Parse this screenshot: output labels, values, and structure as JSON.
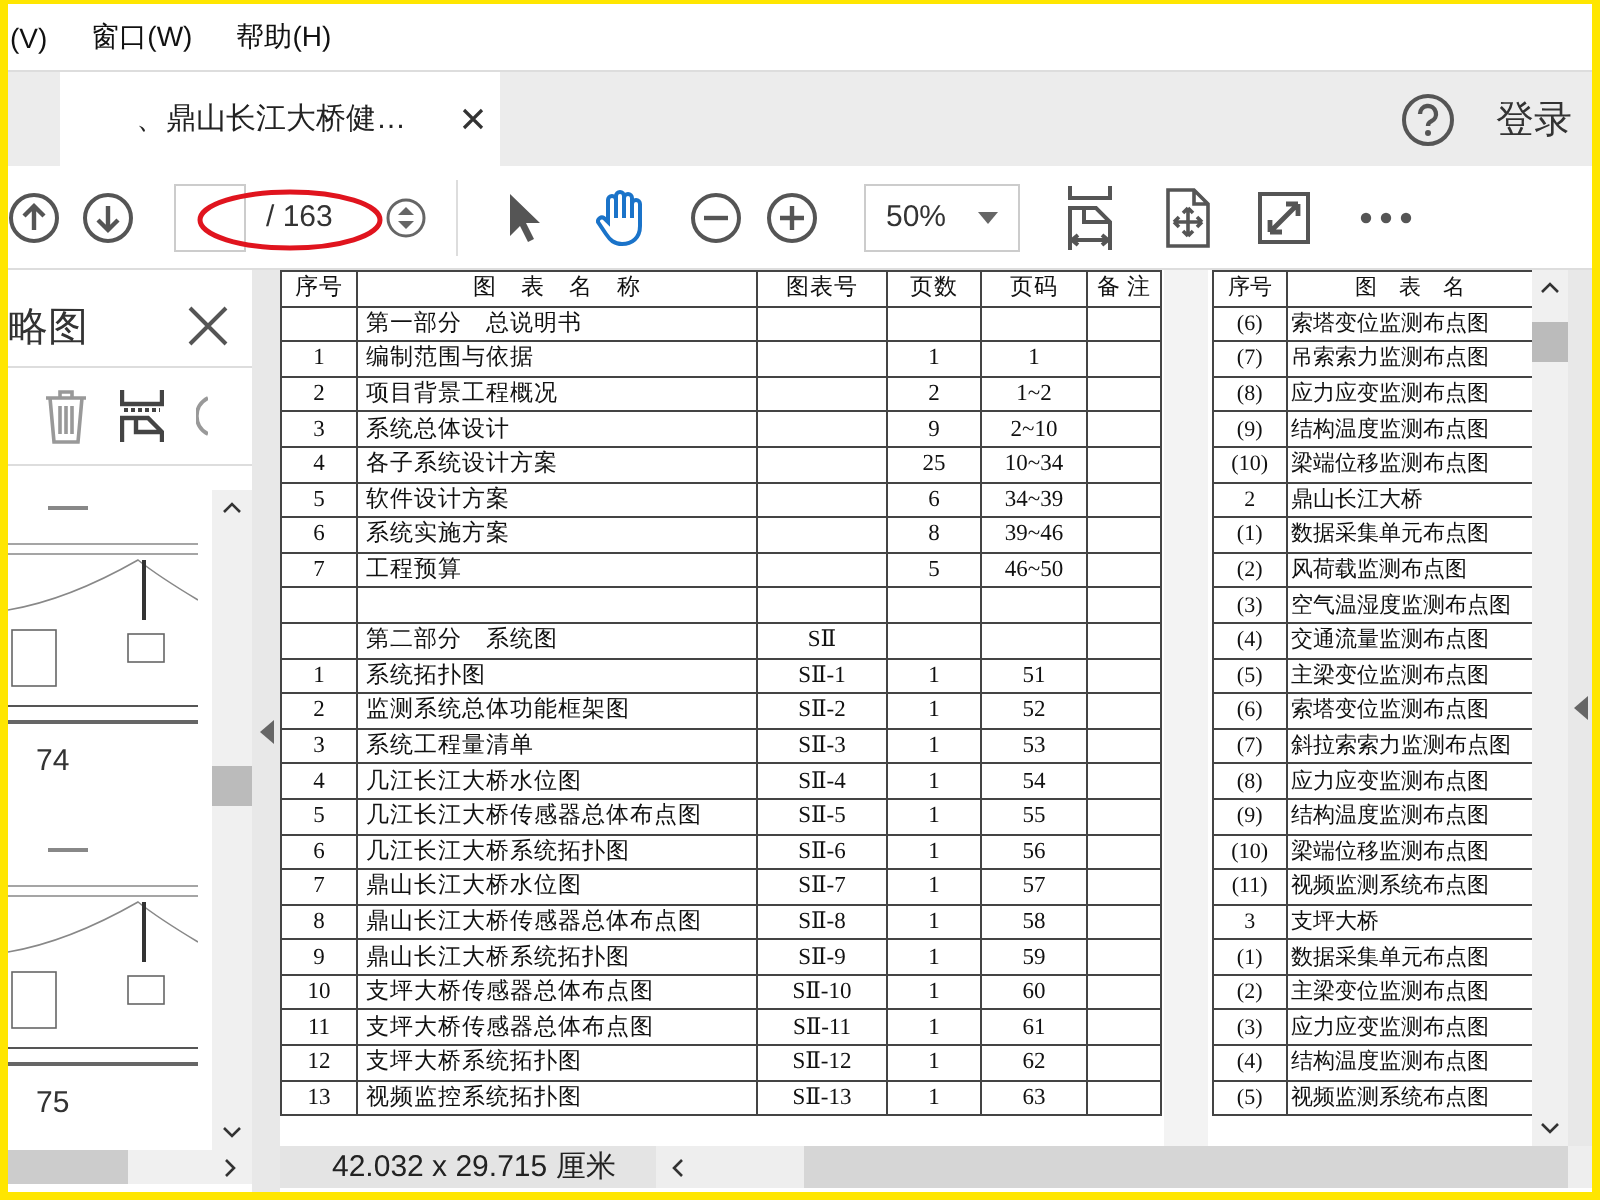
{
  "menu": [
    {
      "label": "(V)"
    },
    {
      "label": "窗口(W)"
    },
    {
      "label": "帮助(H)"
    }
  ],
  "tabs": [
    {
      "title": "、鼎山长江大桥健…",
      "selected": true
    }
  ],
  "account": {
    "label": "登录"
  },
  "toolbar": {
    "page_total": "/ 163",
    "zoom": "50%"
  },
  "sidebar": {
    "title": "略图",
    "pages": [
      {
        "label": "74"
      },
      {
        "label": "75"
      }
    ]
  },
  "document": {
    "left_table": {
      "columns": [
        "序号",
        "图　表　名　称",
        "图表号",
        "页数",
        "页码",
        "备 注"
      ],
      "rows": [
        {
          "name": "第一部分　总说明书"
        },
        {
          "no": "1",
          "name": "编制范围与依据",
          "pages": "1",
          "page_range": "1"
        },
        {
          "no": "2",
          "name": "项目背景工程概况",
          "pages": "2",
          "page_range": "1~2"
        },
        {
          "no": "3",
          "name": "系统总体设计",
          "pages": "9",
          "page_range": "2~10"
        },
        {
          "no": "4",
          "name": "各子系统设计方案",
          "pages": "25",
          "page_range": "10~34"
        },
        {
          "no": "5",
          "name": "软件设计方案",
          "pages": "6",
          "page_range": "34~39"
        },
        {
          "no": "6",
          "name": "系统实施方案",
          "pages": "8",
          "page_range": "39~46"
        },
        {
          "no": "7",
          "name": "工程预算",
          "pages": "5",
          "page_range": "46~50"
        },
        {},
        {
          "name": "第二部分　系统图",
          "code": "SⅡ"
        },
        {
          "no": "1",
          "name": "系统拓扑图",
          "code": "SⅡ-1",
          "pages": "1",
          "page_range": "51"
        },
        {
          "no": "2",
          "name": "监测系统总体功能框架图",
          "code": "SⅡ-2",
          "pages": "1",
          "page_range": "52"
        },
        {
          "no": "3",
          "name": "系统工程量清单",
          "code": "SⅡ-3",
          "pages": "1",
          "page_range": "53"
        },
        {
          "no": "4",
          "name": "几江长江大桥水位图",
          "code": "SⅡ-4",
          "pages": "1",
          "page_range": "54"
        },
        {
          "no": "5",
          "name": "几江长江大桥传感器总体布点图",
          "code": "SⅡ-5",
          "pages": "1",
          "page_range": "55"
        },
        {
          "no": "6",
          "name": "几江长江大桥系统拓扑图",
          "code": "SⅡ-6",
          "pages": "1",
          "page_range": "56"
        },
        {
          "no": "7",
          "name": "鼎山长江大桥水位图",
          "code": "SⅡ-7",
          "pages": "1",
          "page_range": "57"
        },
        {
          "no": "8",
          "name": "鼎山长江大桥传感器总体布点图",
          "code": "SⅡ-8",
          "pages": "1",
          "page_range": "58"
        },
        {
          "no": "9",
          "name": "鼎山长江大桥系统拓扑图",
          "code": "SⅡ-9",
          "pages": "1",
          "page_range": "59"
        },
        {
          "no": "10",
          "name": "支坪大桥传感器总体布点图",
          "code": "SⅡ-10",
          "pages": "1",
          "page_range": "60"
        },
        {
          "no": "11",
          "name": "支坪大桥传感器总体布点图",
          "code": "SⅡ-11",
          "pages": "1",
          "page_range": "61"
        },
        {
          "no": "12",
          "name": "支坪大桥系统拓扑图",
          "code": "SⅡ-12",
          "pages": "1",
          "page_range": "62"
        },
        {
          "no": "13",
          "name": "视频监控系统拓扑图",
          "code": "SⅡ-13",
          "pages": "1",
          "page_range": "63"
        }
      ]
    },
    "right_table": {
      "columns": [
        "序号",
        "图　表　名"
      ],
      "rows": [
        {
          "no": "(6)",
          "name": "索塔变位监测布点图"
        },
        {
          "no": "(7)",
          "name": "吊索索力监测布点图"
        },
        {
          "no": "(8)",
          "name": "应力应变监测布点图"
        },
        {
          "no": "(9)",
          "name": "结构温度监测布点图"
        },
        {
          "no": "(10)",
          "name": "梁端位移监测布点图"
        },
        {
          "no": "2",
          "name": "鼎山长江大桥"
        },
        {
          "no": "(1)",
          "name": "数据采集单元布点图"
        },
        {
          "no": "(2)",
          "name": "风荷载监测布点图"
        },
        {
          "no": "(3)",
          "name": "空气温湿度监测布点图"
        },
        {
          "no": "(4)",
          "name": "交通流量监测布点图"
        },
        {
          "no": "(5)",
          "name": "主梁变位监测布点图"
        },
        {
          "no": "(6)",
          "name": "索塔变位监测布点图"
        },
        {
          "no": "(7)",
          "name": "斜拉索索力监测布点图"
        },
        {
          "no": "(8)",
          "name": "应力应变监测布点图"
        },
        {
          "no": "(9)",
          "name": "结构温度监测布点图"
        },
        {
          "no": "(10)",
          "name": "梁端位移监测布点图"
        },
        {
          "no": "(11)",
          "name": "视频监测系统布点图"
        },
        {
          "no": "3",
          "name": "支坪大桥"
        },
        {
          "no": "(1)",
          "name": "数据采集单元布点图"
        },
        {
          "no": "(2)",
          "name": "主梁变位监测布点图"
        },
        {
          "no": "(3)",
          "name": "应力应变监测布点图"
        },
        {
          "no": "(4)",
          "name": "结构温度监测布点图"
        },
        {
          "no": "(5)",
          "name": "视频监测系统布点图"
        }
      ]
    }
  },
  "status_bar": {
    "page_size": "42.032 x 29.715 厘米"
  }
}
